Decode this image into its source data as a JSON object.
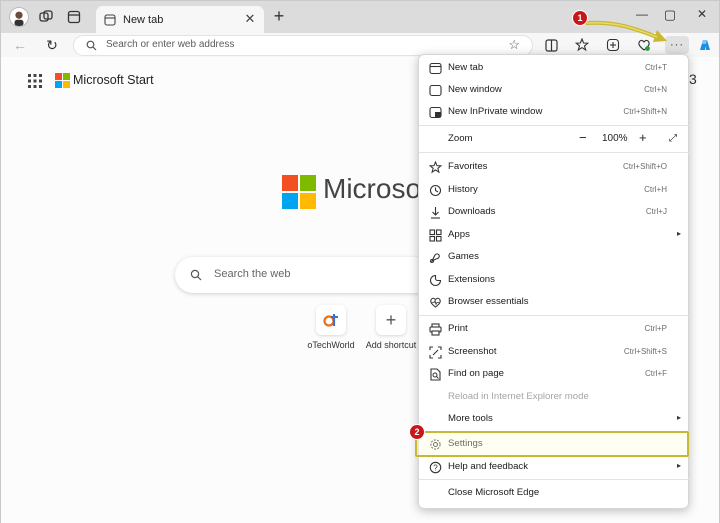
{
  "tab": {
    "title": "New tab"
  },
  "toolbar": {
    "address_placeholder": "Search or enter web address"
  },
  "page": {
    "brand": "Microsoft Start",
    "logo_word": "Microsof",
    "search_placeholder": "Search the web",
    "shortcuts": [
      {
        "label": "oTechWorld",
        "icon": "otechworld-icon"
      },
      {
        "label": "Add shortcut",
        "icon": "plus-icon"
      }
    ],
    "partial_right_char": "3"
  },
  "menu": {
    "new_tab": {
      "label": "New tab",
      "shortcut": "Ctrl+T"
    },
    "new_window": {
      "label": "New window",
      "shortcut": "Ctrl+N"
    },
    "new_inprivate": {
      "label": "New InPrivate window",
      "shortcut": "Ctrl+Shift+N"
    },
    "zoom": {
      "label": "Zoom",
      "minus": "−",
      "value": "100%",
      "plus": "+"
    },
    "favorites": {
      "label": "Favorites",
      "shortcut": "Ctrl+Shift+O"
    },
    "history": {
      "label": "History",
      "shortcut": "Ctrl+H"
    },
    "downloads": {
      "label": "Downloads",
      "shortcut": "Ctrl+J"
    },
    "apps": {
      "label": "Apps"
    },
    "games": {
      "label": "Games"
    },
    "extensions": {
      "label": "Extensions"
    },
    "browser_essentials": {
      "label": "Browser essentials"
    },
    "print": {
      "label": "Print",
      "shortcut": "Ctrl+P"
    },
    "screenshot": {
      "label": "Screenshot",
      "shortcut": "Ctrl+Shift+S"
    },
    "find_on_page": {
      "label": "Find on page",
      "shortcut": "Ctrl+F"
    },
    "reload_ie": {
      "label": "Reload in Internet Explorer mode"
    },
    "more_tools": {
      "label": "More tools"
    },
    "settings": {
      "label": "Settings"
    },
    "help": {
      "label": "Help and feedback"
    },
    "close_edge": {
      "label": "Close Microsoft Edge"
    }
  },
  "annotations": {
    "badge_1": "1",
    "badge_2": "2"
  },
  "colors": {
    "accent_highlight": "#c9b833",
    "badge_red": "#c8171a",
    "logo_red": "#f25022",
    "logo_green": "#7fba00",
    "logo_blue": "#00a4ef",
    "logo_yellow": "#ffb900"
  }
}
